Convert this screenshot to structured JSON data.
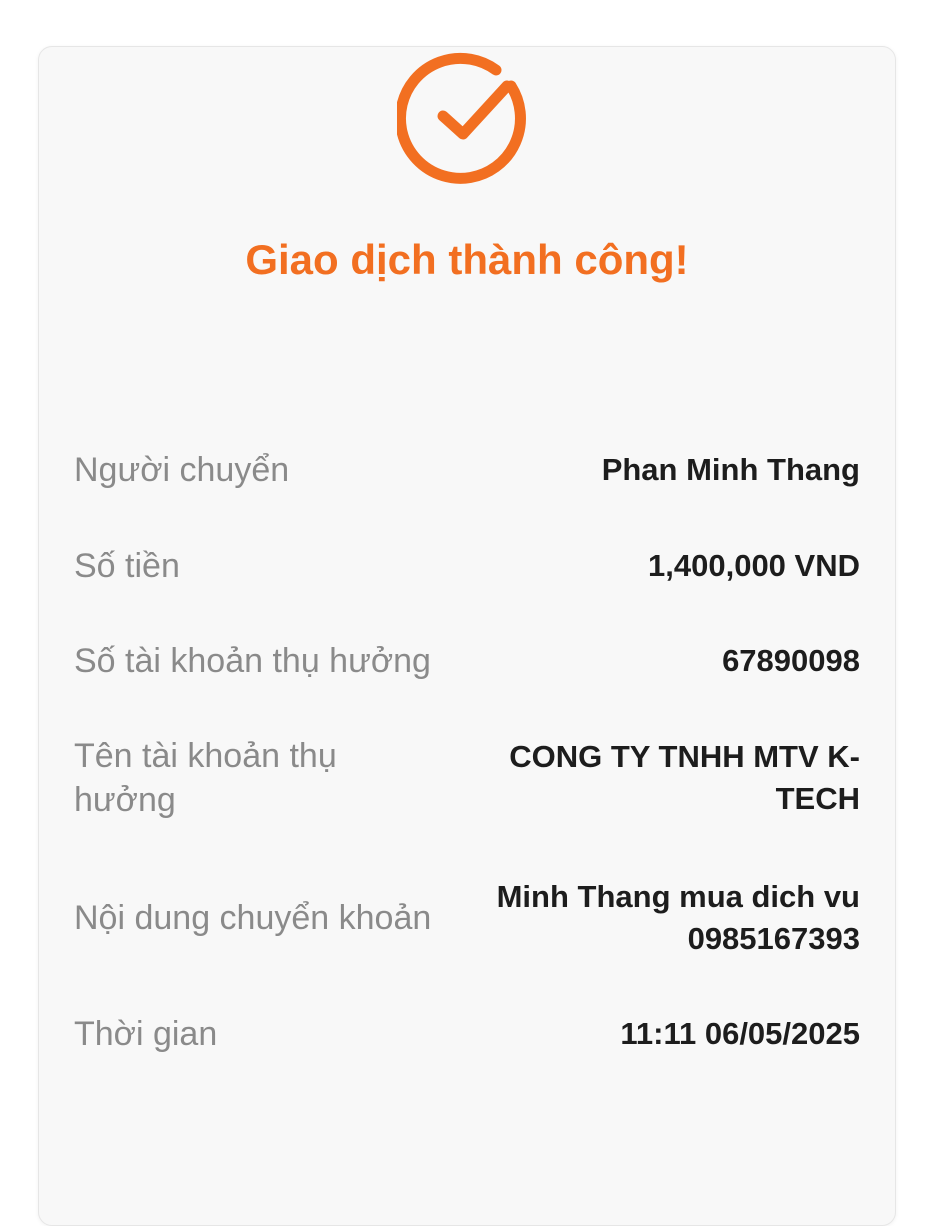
{
  "status": {
    "icon": "check-circle-icon",
    "title": "Giao dịch thành công!",
    "accent_color": "#f26f21"
  },
  "details": [
    {
      "label": "Người chuyển",
      "value": "Phan Minh Thang"
    },
    {
      "label": "Số tiền",
      "value": "1,400,000 VND"
    },
    {
      "label": "Số tài khoản thụ hưởng",
      "value": "67890098"
    },
    {
      "label": "Tên tài khoản thụ hưởng",
      "value": "CONG TY TNHH MTV K-TECH"
    },
    {
      "label": "Nội dung chuyển khoản",
      "value": "Minh Thang mua dich vu 0985167393"
    },
    {
      "label": "Thời gian",
      "value": "11:11 06/05/2025"
    }
  ]
}
